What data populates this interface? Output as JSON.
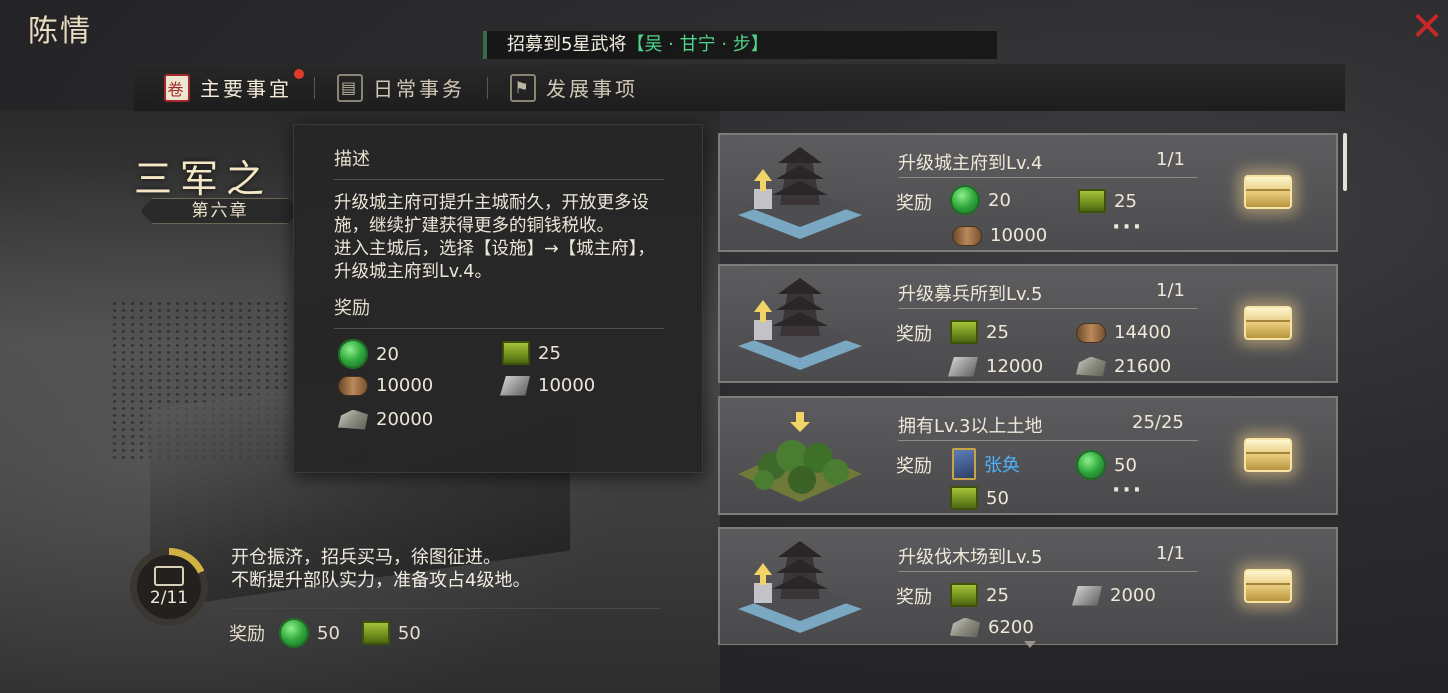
{
  "window": {
    "title": "陈情"
  },
  "ticker": {
    "text": "招募到5星武将",
    "highlight": "【吴 · 甘宁 · 步】"
  },
  "tabs": [
    {
      "label": "主要事宜",
      "icon": "scroll-icon",
      "active": true
    },
    {
      "label": "日常事务",
      "icon": "notebook-icon",
      "active": false
    },
    {
      "label": "发展事项",
      "icon": "flag-icon",
      "active": false
    }
  ],
  "chapter": {
    "title": "三军之",
    "subtitle": "第六章"
  },
  "tooltip": {
    "desc_header": "描述",
    "desc": "升级城主府可提升主城耐久，开放更多设施，继续扩建获得更多的铜钱税收。\n进入主城后，选择【设施】→【城主府】，升级城主府到Lv.4。",
    "reward_header": "奖励",
    "rewards": [
      {
        "icon": "jade-icon",
        "value": "20"
      },
      {
        "icon": "crate-icon",
        "value": "25"
      },
      {
        "icon": "wood-icon",
        "value": "10000"
      },
      {
        "icon": "iron-icon",
        "value": "10000"
      },
      {
        "icon": "stone-icon",
        "value": "20000"
      }
    ]
  },
  "chapter_panel": {
    "progress": "2/11",
    "progress_fraction": 0.18,
    "desc": "开仓振济，招兵买马，徐图征进。\n不断提升部队实力，准备攻占4级地。",
    "reward_label": "奖励",
    "rewards": [
      {
        "icon": "jade-icon",
        "value": "50"
      },
      {
        "icon": "crate-icon",
        "value": "50"
      }
    ]
  },
  "quests": [
    {
      "name": "升级城主府到Lv.4",
      "progress": "1/1",
      "reward_label": "奖励",
      "thumb": "palace-upgrade",
      "rewards": [
        {
          "icon": "jade-icon",
          "value": "20"
        },
        {
          "icon": "crate-icon",
          "value": "25"
        },
        {
          "icon": "wood-icon",
          "value": "10000"
        }
      ],
      "more": "···"
    },
    {
      "name": "升级募兵所到Lv.5",
      "progress": "1/1",
      "reward_label": "奖励",
      "thumb": "palace-upgrade",
      "rewards": [
        {
          "icon": "crate-icon",
          "value": "25"
        },
        {
          "icon": "wood-icon",
          "value": "14400"
        },
        {
          "icon": "iron-icon",
          "value": "12000"
        },
        {
          "icon": "stone-icon",
          "value": "21600"
        }
      ]
    },
    {
      "name": "拥有Lv.3以上土地",
      "progress": "25/25",
      "reward_label": "奖励",
      "thumb": "forest-land",
      "rewards": [
        {
          "icon": "hero-card-icon",
          "value": "张奂"
        },
        {
          "icon": "jade-icon",
          "value": "50"
        },
        {
          "icon": "crate-icon",
          "value": "50"
        }
      ],
      "more": "···"
    },
    {
      "name": "升级伐木场到Lv.5",
      "progress": "1/1",
      "reward_label": "奖励",
      "thumb": "palace-upgrade",
      "rewards": [
        {
          "icon": "crate-icon",
          "value": "25"
        },
        {
          "icon": "iron-icon",
          "value": "2000"
        },
        {
          "icon": "stone-icon",
          "value": "6200"
        }
      ]
    }
  ],
  "close": {
    "icon": "close-icon",
    "glyph": "✕"
  },
  "colors": {
    "accent_red": "#c6282a",
    "hero_blue": "#4db4ff",
    "highlight_green": "#4fd48a"
  }
}
